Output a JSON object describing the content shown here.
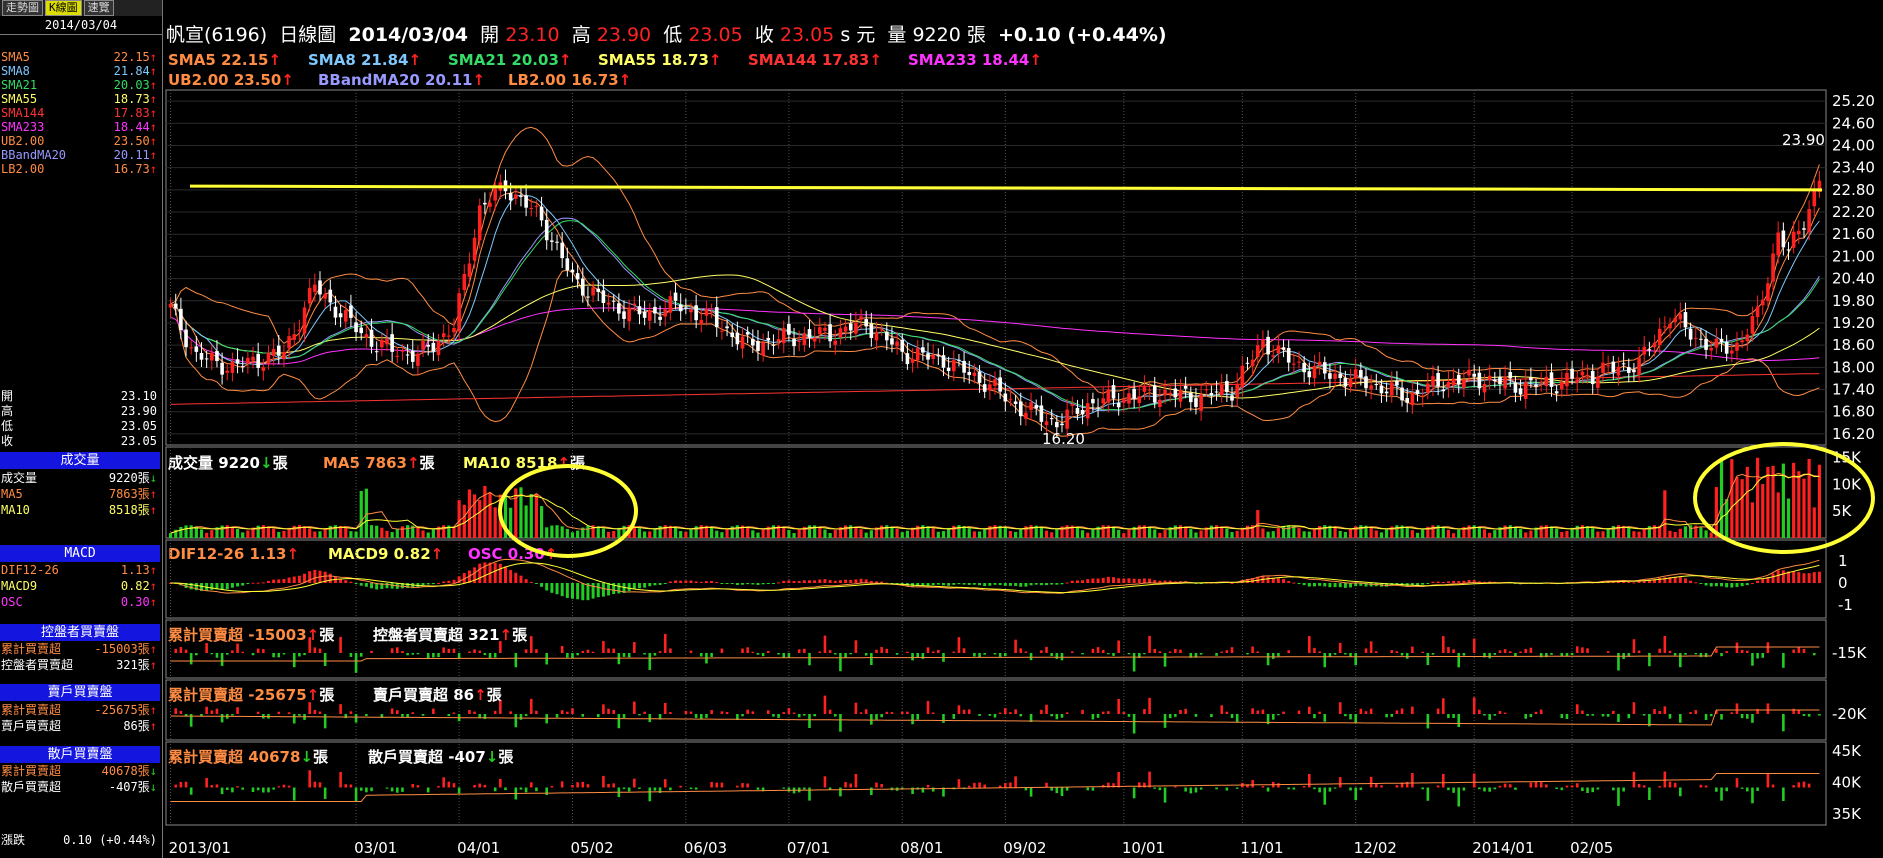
{
  "tabs": [
    "走勢圖",
    "K線圖",
    "速覽"
  ],
  "date": "2014/03/04",
  "title": {
    "name": "帆宣(6196)",
    "period": "日線圖",
    "date": "2014/03/04",
    "open_lbl": "開",
    "open": "23.10",
    "high_lbl": "高",
    "high": "23.90",
    "low_lbl": "低",
    "low": "23.05",
    "close_lbl": "收",
    "close": "23.05",
    "unit": "s 元",
    "vol_lbl": "量",
    "vol": "9220 張",
    "chg": "+0.10 (+0.44%)"
  },
  "colors": {
    "up": "#ff2020",
    "down": "#22cc22",
    "bg": "#000000",
    "grid": "#333333",
    "yellow": "#ffff33",
    "sma5": "#ff8c42",
    "sma8": "#7ec8ff",
    "sma21": "#33dd66",
    "sma55": "#ffff66",
    "sma144": "#ff3333",
    "sma233": "#ff33ff",
    "ub": "#ff8c42",
    "bband": "#9999ff",
    "lb": "#ff8c42"
  },
  "left": {
    "sma": [
      {
        "l": "SMA5",
        "v": "22.15",
        "c": "#ff8c42"
      },
      {
        "l": "SMA8",
        "v": "21.84",
        "c": "#7ec8ff"
      },
      {
        "l": "SMA21",
        "v": "20.03",
        "c": "#33dd66"
      },
      {
        "l": "SMA55",
        "v": "18.73",
        "c": "#ffff66"
      },
      {
        "l": "SMA144",
        "v": "17.83",
        "c": "#ff3333"
      },
      {
        "l": "SMA233",
        "v": "18.44",
        "c": "#ff33ff"
      },
      {
        "l": "UB2.00",
        "v": "23.50",
        "c": "#ff8c42"
      },
      {
        "l": "BBandMA20",
        "v": "20.11",
        "c": "#9999ff"
      },
      {
        "l": "LB2.00",
        "v": "16.73",
        "c": "#ff8c42"
      }
    ],
    "ohlc": [
      {
        "l": "開",
        "v": "23.10"
      },
      {
        "l": "高",
        "v": "23.90"
      },
      {
        "l": "低",
        "v": "23.05"
      },
      {
        "l": "收",
        "v": "23.05"
      }
    ],
    "vol_hdr": "成交量",
    "vol": [
      {
        "l": "成交量",
        "v": "9220張",
        "c": "#fff"
      },
      {
        "l": "MA5",
        "v": "7863張",
        "c": "#ff8c42"
      },
      {
        "l": "MA10",
        "v": "8518張",
        "c": "#ffff66"
      }
    ],
    "macd_hdr": "MACD",
    "macd": [
      {
        "l": "DIF12-26",
        "v": "1.13",
        "c": "#ff8c42"
      },
      {
        "l": "MACD9",
        "v": "0.82",
        "c": "#ffff66"
      },
      {
        "l": "OSC",
        "v": "0.30",
        "c": "#ff33ff"
      }
    ],
    "ctl_hdr": "控盤者買賣盤",
    "ctl": [
      {
        "l": "累計買賣超",
        "v": "-15003張",
        "c": "#ff8c42"
      },
      {
        "l": "控盤者買賣超",
        "v": "321張",
        "c": "#fff"
      }
    ],
    "big_hdr": "賣戶買賣盤",
    "big": [
      {
        "l": "累計買賣超",
        "v": "-25675張",
        "c": "#ff8c42"
      },
      {
        "l": "賣戶買賣超",
        "v": "86張",
        "c": "#fff"
      }
    ],
    "small_hdr": "散戶買賣盤",
    "small": [
      {
        "l": "累計買賣超",
        "v": "40678張",
        "c": "#ff8c42"
      },
      {
        "l": "散戶買賣超",
        "v": "-407張",
        "c": "#fff"
      }
    ],
    "bottom": [
      {
        "l": "漲跌",
        "v": "0.10 (+0.44%)"
      }
    ]
  },
  "legends": {
    "main1": [
      {
        "t": "SMA5 22.15",
        "c": "#ff8c42"
      },
      {
        "t": "SMA8 21.84",
        "c": "#7ec8ff"
      },
      {
        "t": "SMA21 20.03",
        "c": "#33dd66"
      },
      {
        "t": "SMA55 18.73",
        "c": "#ffff66"
      },
      {
        "t": "SMA144 17.83",
        "c": "#ff3333"
      },
      {
        "t": "SMA233 18.44",
        "c": "#ff33ff"
      }
    ],
    "main2": [
      {
        "t": "UB2.00 23.50",
        "c": "#ff8c42"
      },
      {
        "t": "BBandMA20 20.11",
        "c": "#9999ff"
      },
      {
        "t": "LB2.00 16.73",
        "c": "#ff8c42"
      }
    ],
    "vol": [
      {
        "t": "成交量 9220",
        "c": "#fff",
        "a": "dn",
        "u": "張"
      },
      {
        "t": "MA5 7863",
        "c": "#ff8c42",
        "a": "up",
        "u": "張"
      },
      {
        "t": "MA10 8518",
        "c": "#ffff66",
        "a": "up",
        "u": "張"
      }
    ],
    "macd": [
      {
        "t": "DIF12-26 1.13",
        "c": "#ff8c42",
        "a": "up"
      },
      {
        "t": "MACD9 0.82",
        "c": "#ffff66",
        "a": "up"
      },
      {
        "t": "OSC 0.30",
        "c": "#ff33ff",
        "a": "up"
      }
    ],
    "ctl": [
      {
        "t": "累計買賣超 -15003",
        "c": "#ff8c42",
        "a": "up",
        "u": "張"
      },
      {
        "t": "控盤者買賣超 321",
        "c": "#fff",
        "a": "up",
        "u": "張"
      }
    ],
    "big": [
      {
        "t": "累計買賣超 -25675",
        "c": "#ff8c42",
        "a": "up",
        "u": "張"
      },
      {
        "t": "賣戶買賣超 86",
        "c": "#fff",
        "a": "up",
        "u": "張"
      }
    ],
    "small": [
      {
        "t": "累計買賣超 40678",
        "c": "#ff8c42",
        "a": "dn",
        "u": "張"
      },
      {
        "t": "散戶買賣超 -407",
        "c": "#fff",
        "a": "dn",
        "u": "張"
      }
    ]
  },
  "chart_data": {
    "type": "candlestick",
    "price_axis": [
      "25.20",
      "24.60",
      "24.00",
      "23.40",
      "22.80",
      "22.20",
      "21.60",
      "21.00",
      "20.40",
      "19.80",
      "19.20",
      "18.60",
      "18.00",
      "17.40",
      "16.80",
      "16.20"
    ],
    "vol_axis": [
      "15K",
      "10K",
      "5K"
    ],
    "macd_axis": [
      "1",
      "0",
      "-1"
    ],
    "ctl_axis": [
      "-15K"
    ],
    "big_axis": [
      "-20K"
    ],
    "small_axis": [
      "45K",
      "40K",
      "35K"
    ],
    "x_labels": [
      "2013/01",
      "03/01",
      "04/01",
      "05/02",
      "06/03",
      "07/01",
      "08/01",
      "09/02",
      "10/01",
      "11/01",
      "12/02",
      "2014/01",
      "02/05"
    ],
    "annotations": [
      {
        "text": "23.90"
      },
      {
        "text": "16.20"
      }
    ],
    "close_anchors": [
      [
        0,
        19.6
      ],
      [
        5,
        18.3
      ],
      [
        12,
        18.0
      ],
      [
        22,
        18.4
      ],
      [
        28,
        20.2
      ],
      [
        34,
        19.3
      ],
      [
        40,
        18.6
      ],
      [
        48,
        18.3
      ],
      [
        55,
        19.1
      ],
      [
        60,
        22.3
      ],
      [
        65,
        22.9
      ],
      [
        72,
        22.0
      ],
      [
        78,
        20.4
      ],
      [
        85,
        19.7
      ],
      [
        92,
        19.4
      ],
      [
        98,
        19.7
      ],
      [
        105,
        19.3
      ],
      [
        112,
        18.6
      ],
      [
        120,
        18.8
      ],
      [
        128,
        18.9
      ],
      [
        135,
        19.2
      ],
      [
        142,
        18.4
      ],
      [
        150,
        18.2
      ],
      [
        158,
        17.6
      ],
      [
        165,
        16.9
      ],
      [
        172,
        16.5
      ],
      [
        178,
        17.0
      ],
      [
        185,
        17.2
      ],
      [
        192,
        17.3
      ],
      [
        199,
        17.2
      ],
      [
        206,
        17.4
      ],
      [
        212,
        18.7
      ],
      [
        218,
        18.1
      ],
      [
        225,
        17.8
      ],
      [
        232,
        17.6
      ],
      [
        240,
        17.2
      ],
      [
        247,
        17.6
      ],
      [
        254,
        17.7
      ],
      [
        262,
        17.5
      ],
      [
        270,
        17.6
      ],
      [
        278,
        17.9
      ],
      [
        285,
        18.1
      ],
      [
        291,
        19.4
      ],
      [
        296,
        18.8
      ],
      [
        300,
        18.5
      ],
      [
        304,
        18.6
      ],
      [
        308,
        19.4
      ],
      [
        312,
        21.6
      ],
      [
        314,
        21.1
      ],
      [
        317,
        22.0
      ],
      [
        320,
        23.05
      ]
    ],
    "trendline": {
      "from": 22.9,
      "to": 22.8
    },
    "highlights": [
      "volume spike Apr-May 2013",
      "volume spike Feb-Mar 2014"
    ]
  }
}
